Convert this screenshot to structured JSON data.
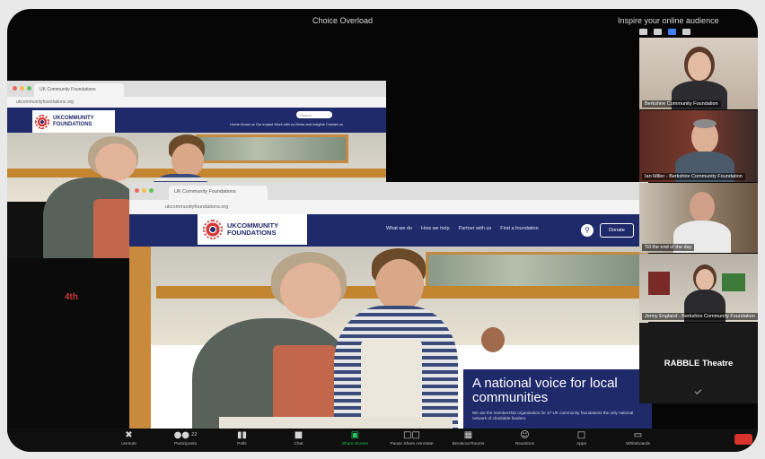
{
  "zoom": {
    "share_title": "Choice Overload",
    "sidebar_title": "Inspire your online audience"
  },
  "back_browser": {
    "tab_label": "UK Community Foundations",
    "url": "ukcommunityfoundations.org",
    "logo_line1": "UKCOMMUNITY",
    "logo_line2": "FOUNDATIONS",
    "nav_links": "Home  About us  Our impact  Work with us  News and insights  Contact us",
    "search_label": "Search"
  },
  "front_browser": {
    "tab_label": "UK Community Foundations",
    "url": "ukcommunityfoundations.org",
    "logo_line1": "UKCOMMUNITY",
    "logo_line2": "FOUNDATIONS",
    "nav": [
      "What we do",
      "How we help",
      "Partner with us",
      "Find a foundation"
    ],
    "donate_label": "Donate",
    "hero_heading": "A national voice for local communities",
    "hero_body": "We are the membership organisation for 47 UK community foundations the only national network of charitable funders."
  },
  "participants": [
    {
      "name": "Berkshire Community Foundation"
    },
    {
      "name": "Ian Miller - Berkshire Community Foundation"
    },
    {
      "name": "Till the end of the day"
    },
    {
      "name": "Jenny England - Berkshire Community Foundation"
    },
    {
      "name": "RABBLE Theatre"
    }
  ],
  "toolbar": [
    {
      "label": "Unmute",
      "icon": "microphone-muted-icon"
    },
    {
      "label": "Participants",
      "icon": "participants-icon",
      "count": "22"
    },
    {
      "label": "Polls",
      "icon": "polls-icon"
    },
    {
      "label": "Chat",
      "icon": "chat-icon"
    },
    {
      "label": "Share Screen",
      "icon": "share-screen-icon"
    },
    {
      "label": "Pause Share Annotate",
      "icon": "pause-share-icon"
    },
    {
      "label": "Breakout Rooms",
      "icon": "breakout-rooms-icon"
    },
    {
      "label": "Reactions",
      "icon": "reactions-icon"
    },
    {
      "label": "Apps",
      "icon": "apps-icon"
    },
    {
      "label": "Whiteboards",
      "icon": "whiteboards-icon"
    }
  ],
  "colors": {
    "zoom_black": "#060606",
    "ukcf_navy": "#1f2a6b",
    "ukcf_red": "#d43a3a",
    "share_green": "#23c45b",
    "end_red": "#d9342b"
  }
}
